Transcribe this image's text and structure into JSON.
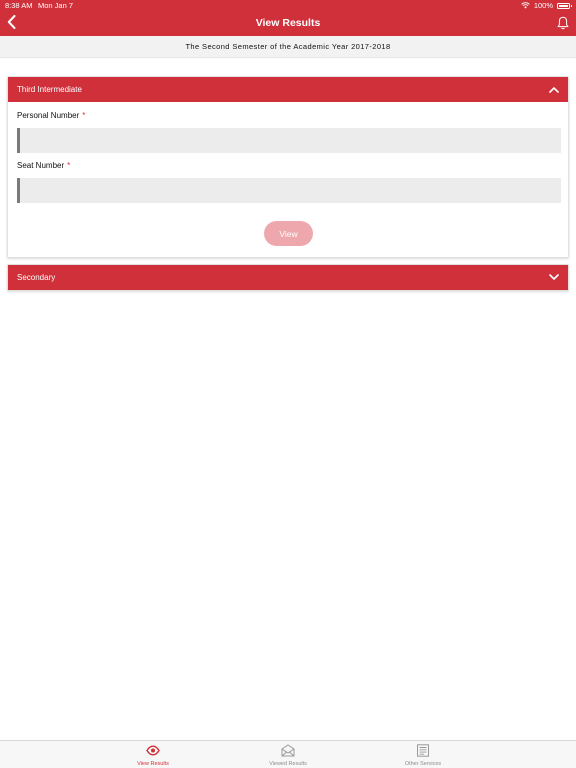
{
  "status_bar": {
    "time": "8:38 AM",
    "date": "Mon Jan 7",
    "battery": "100%"
  },
  "nav": {
    "title": "View Results",
    "back_icon": "chevron-left-icon",
    "bell_icon": "bell-icon"
  },
  "semester_text": "The Second Semester of the Academic Year 2017-2018",
  "sections": [
    {
      "title": "Third Intermediate",
      "expanded": true,
      "fields": [
        {
          "label": "Personal Number",
          "required_mark": "*",
          "value": ""
        },
        {
          "label": "Seat Number",
          "required_mark": "*",
          "value": ""
        }
      ],
      "button_label": "View"
    },
    {
      "title": "Secondary",
      "expanded": false
    }
  ],
  "tabs": [
    {
      "label": "View Results",
      "icon": "eye-icon",
      "active": true
    },
    {
      "label": "Viewed Results",
      "icon": "envelope-open-icon",
      "active": false
    },
    {
      "label": "Other Services",
      "icon": "list-icon",
      "active": false
    }
  ],
  "colors": {
    "brand_red": "#d0303a",
    "button_disabled": "#eea8ad",
    "input_bg": "#ececec"
  }
}
